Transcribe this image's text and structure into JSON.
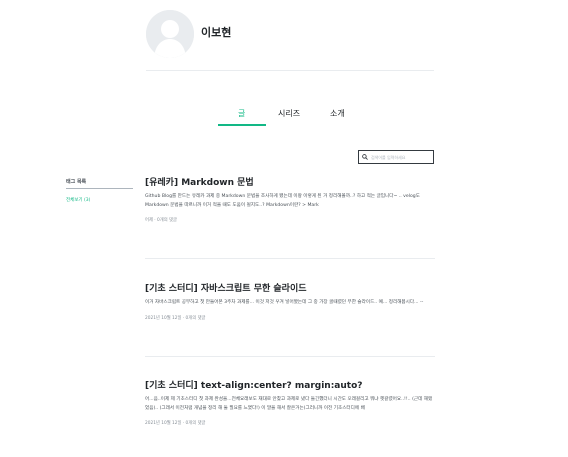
{
  "profile": {
    "name": "이보현"
  },
  "tabs": [
    {
      "label": "글",
      "active": true
    },
    {
      "label": "시리즈",
      "active": false
    },
    {
      "label": "소개",
      "active": false
    }
  ],
  "search": {
    "placeholder": "검색어를 입력하세요"
  },
  "tags": {
    "title": "태그 목록",
    "items": [
      {
        "label": "전체보기 (3)"
      }
    ]
  },
  "posts": [
    {
      "title": "[유레카] Markdown 문법",
      "desc": "Github Blog를 만드는 유레카 과제 중 Markdown 문법을 조사하게 됐는데 이왕 이렇게 된 거 정리해볼까..? 하고 적는 글입니다~ .. velog도 Markdown 문법을 따르니까 이거 적을 때도 도움이 될지도..? Markdown이란? > Mark",
      "meta": "어제 · 0개의 댓글"
    },
    {
      "title": "[기초 스터디] 자바스크립트 무한 슬라이드",
      "desc": "이거 자바스크립트 공부하고 첫 만들어본 3주차 과제를... 이것 저것 우겨 넣어봤는데 그 중 가장 골때렸던 무한 슬라이드.. 예... 정리해봅시다... --",
      "meta": "2021년 10월 12일 · 0개의 댓글"
    },
    {
      "title": "[기초 스터디] text-align:center? margin:auto?",
      "desc": "어...음..이제 제 기초스터디 첫 과제 완성을...전체요래보도 재대로 안찾고 과제로 냈다 들긴했더니 시간도 오래걸리고 뭐냐 헷갈렸어요..!!.. (근데 해맸었음).. (그래서 이전처럼 개념을 정리 해 둘 필요를 느꼈다!) 이 말을 해서 잘은거는)그러니까 이전 기초스터디에 배",
      "meta": "2021년 10월 12일 · 0개의 댓글"
    }
  ],
  "colors": {
    "accent": "#12b886",
    "text": "#212529",
    "muted": "#868e96",
    "line": "#e9ecef"
  }
}
